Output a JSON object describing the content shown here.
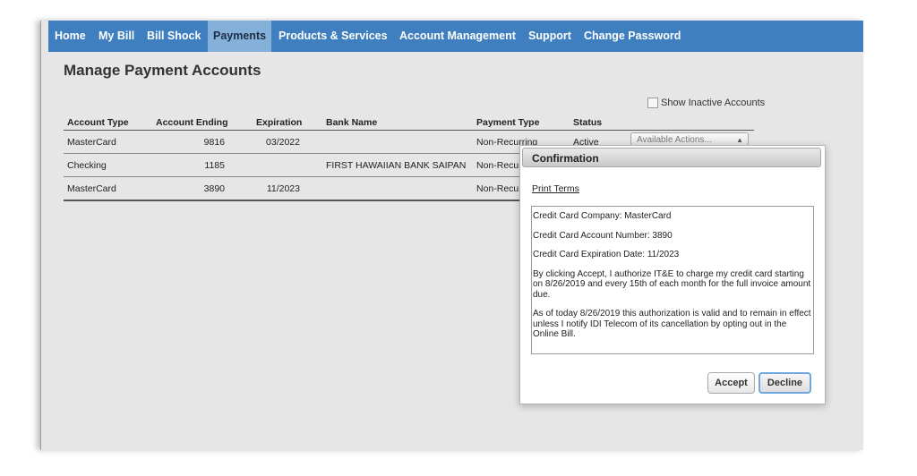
{
  "nav": {
    "items": [
      {
        "label": "Home"
      },
      {
        "label": "My Bill"
      },
      {
        "label": "Bill Shock"
      },
      {
        "label": "Payments",
        "active": true
      },
      {
        "label": "Products & Services"
      },
      {
        "label": "Account Management"
      },
      {
        "label": "Support"
      },
      {
        "label": "Change Password"
      }
    ]
  },
  "page": {
    "title": "Manage Payment Accounts",
    "show_inactive_label": "Show Inactive Accounts",
    "show_inactive_checked": false
  },
  "table": {
    "headers": [
      "Account Type",
      "Account Ending",
      "Expiration",
      "Bank Name",
      "Payment Type",
      "Status"
    ],
    "rows": [
      {
        "type": "MasterCard",
        "ending": "9816",
        "expiration": "03/2022",
        "bank": "",
        "payment_type": "Non-Recurring",
        "status": "Active",
        "actions": "Available Actions..."
      },
      {
        "type": "Checking",
        "ending": "1185",
        "expiration": "",
        "bank": "FIRST HAWAIIAN BANK SAIPAN",
        "payment_type": "Non-Recur",
        "status": "",
        "actions": ""
      },
      {
        "type": "MasterCard",
        "ending": "3890",
        "expiration": "11/2023",
        "bank": "",
        "payment_type": "Non-Recur",
        "status": "",
        "actions": ""
      }
    ]
  },
  "modal": {
    "title": "Confirmation",
    "print_terms": "Print Terms",
    "terms": {
      "company": "Credit Card Company: MasterCard",
      "account_number": "Credit Card Account Number: 3890",
      "expiration": "Credit Card Expiration Date:  11/2023",
      "authorize": "By clicking Accept, I authorize IT&E to charge my credit card starting on 8/26/2019 and every 15th of each month for the full invoice amount due.",
      "valid": "As of today 8/26/2019 this authorization is valid and to remain in effect unless I notify IDI Telecom of its cancellation by opting out in the Online Bill."
    },
    "accept_label": "Accept",
    "decline_label": "Decline"
  },
  "colors": {
    "nav_bg": "#3f7fbf",
    "nav_active_bg": "#84b0da",
    "page_bg": "#e6e6e6",
    "decline_focus": "#6fa8df"
  }
}
